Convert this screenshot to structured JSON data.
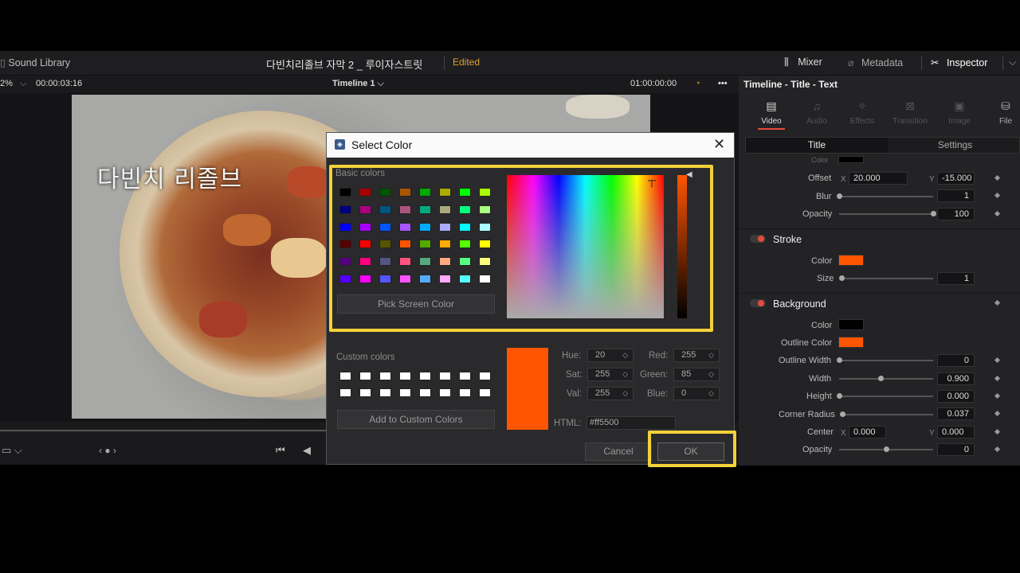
{
  "topbar": {
    "sound_library": "Sound Library",
    "project_title": "다빈치리졸브 자막 2 _ 루이자스트릿",
    "edited": "Edited",
    "mixer": "Mixer",
    "metadata": "Metadata",
    "inspector": "Inspector"
  },
  "viewer_bar": {
    "zoom": "2%",
    "timecode": "00:00:03:16",
    "timeline": "Timeline 1",
    "end_timecode": "01:00:00:00"
  },
  "subtitle_text": "다빈치 리졸브",
  "inspector": {
    "title": "Timeline - Title - Text",
    "tabs": [
      "Video",
      "Audio",
      "Effects",
      "Transition",
      "Image",
      "File"
    ],
    "subtabs": [
      "Title",
      "Settings"
    ],
    "shadow": {
      "color_label": "Color",
      "offset_label": "Offset",
      "offset_x": "20.000",
      "offset_y": "-15.000",
      "blur_label": "Blur",
      "blur": "1",
      "opacity_label": "Opacity",
      "opacity": "100",
      "blur_level": 0.0,
      "opacity_level": 1.0
    },
    "stroke": {
      "title": "Stroke",
      "color_label": "Color",
      "size_label": "Size",
      "size": "1",
      "color": "#ff5500"
    },
    "background": {
      "title": "Background",
      "color_label": "Color",
      "outline_color_label": "Outline Color",
      "outline_width_label": "Outline Width",
      "outline_width": "0",
      "width_label": "Width",
      "width": "0.900",
      "height_label": "Height",
      "height": "0.000",
      "corner_radius_label": "Corner Radius",
      "corner_radius": "0.037",
      "center_label": "Center",
      "center_x": "0.000",
      "center_y": "0.000",
      "opacity_label": "Opacity",
      "opacity": "0",
      "color": "#000000",
      "outline_color": "#ff5500"
    },
    "x": "X",
    "y": "Y"
  },
  "dialog": {
    "title": "Select Color",
    "basic_colors_label": "Basic colors",
    "basic_colors": [
      [
        "#000000",
        "#aa0000",
        "#005500",
        "#aa5500",
        "#00aa00",
        "#aaaa00",
        "#00ff00",
        "#aaff00"
      ],
      [
        "#00007f",
        "#aa007f",
        "#00557f",
        "#aa557f",
        "#00aa7f",
        "#aaaa7f",
        "#00ff7f",
        "#aaff7f"
      ],
      [
        "#0000ff",
        "#aa00ff",
        "#0055ff",
        "#aa55ff",
        "#00aaff",
        "#aaaaff",
        "#00ffff",
        "#aaffff"
      ],
      [
        "#550000",
        "#ff0000",
        "#555500",
        "#ff5500",
        "#55aa00",
        "#ffaa00",
        "#55ff00",
        "#ffff00"
      ],
      [
        "#55007f",
        "#ff007f",
        "#55557f",
        "#ff557f",
        "#55aa7f",
        "#ffaa7f",
        "#55ff7f",
        "#ffff7f"
      ],
      [
        "#5500ff",
        "#ff00ff",
        "#5555ff",
        "#ff55ff",
        "#55aaff",
        "#ffaaff",
        "#55ffff",
        "#ffffff"
      ]
    ],
    "pick_screen_color": "Pick Screen Color",
    "custom_colors_label": "Custom colors",
    "add_to_custom": "Add to Custom Colors",
    "hue_label": "Hue:",
    "hue": "20",
    "sat_label": "Sat:",
    "sat": "255",
    "val_label": "Val:",
    "val": "255",
    "red_label": "Red:",
    "red": "255",
    "green_label": "Green:",
    "green": "85",
    "blue_label": "Blue:",
    "blue": "0",
    "html_label": "HTML:",
    "html": "#ff5500",
    "current_color": "#ff5500",
    "cancel": "Cancel",
    "ok": "OK"
  },
  "highlight_color": "#f2d13a"
}
